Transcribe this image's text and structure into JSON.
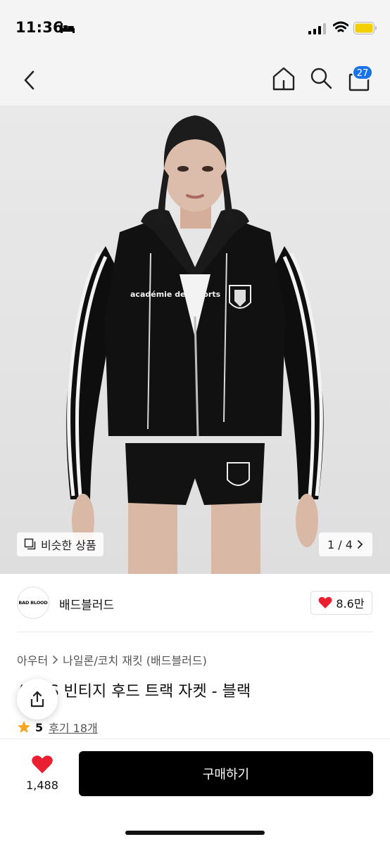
{
  "status_bar": {
    "time": "11:36",
    "icons": [
      "bed-icon",
      "signal-icon",
      "wifi-icon",
      "battery-icon"
    ]
  },
  "nav": {
    "icons": [
      "back-icon",
      "home-icon",
      "search-icon",
      "cart-icon"
    ],
    "cart_badge": "27"
  },
  "product_image": {
    "chest_logo_text": "académie des sports",
    "similar_label": "비슷한 상품",
    "pager": "1 / 4"
  },
  "brand": {
    "logo_text": "BAD BLOOD",
    "name": "배드블러드",
    "like_count": "8.6만"
  },
  "breadcrumb": {
    "category": "아우터",
    "subcategory": "나일론/코치 재킷 (배드블러드)"
  },
  "product": {
    "title": "A.D.S 빈티지 후드 트랙 자켓 - 블랙",
    "rating": "5",
    "review_link": "후기 18개"
  },
  "bottom_bar": {
    "wish_count": "1,488",
    "buy_label": "구매하기"
  },
  "colors": {
    "accent": "#1a73e8",
    "heart": "#e8202f",
    "star": "#f5a623",
    "buy_button": "#000000"
  }
}
